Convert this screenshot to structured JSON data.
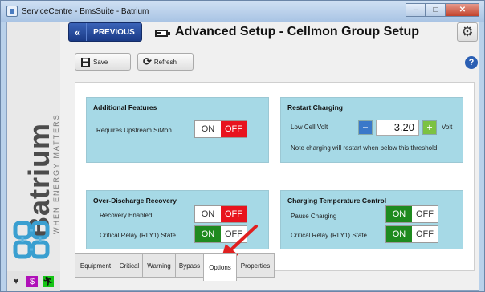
{
  "window": {
    "title": "ServiceCentre - BmsSuite - Batrium",
    "controls": {
      "minimize": "–",
      "maximize": "□",
      "close": "✕"
    }
  },
  "sidebar": {
    "brand": "Batrium",
    "tagline": "WHEN ENERGY MATTERS",
    "bottom_icons": [
      "heart-icon",
      "dollar-icon",
      "runner-icon"
    ]
  },
  "header": {
    "previous_label": "PREVIOUS",
    "previous_glyph": "«",
    "page_title": "Advanced Setup - Cellmon Group Setup"
  },
  "toolbar": {
    "save_label": "Save",
    "refresh_label": "Refresh",
    "help_glyph": "?"
  },
  "groups": {
    "additional_features": {
      "title": "Additional Features",
      "rows": [
        {
          "label": "Requires Upstream SiMon",
          "on": "ON",
          "off": "OFF",
          "state": "off"
        }
      ]
    },
    "restart_charging": {
      "title": "Restart Charging",
      "low_cell_volt_label": "Low Cell Volt",
      "low_cell_volt_value": "3.20",
      "unit": "Volt",
      "minus": "−",
      "plus": "+",
      "note": "Note charging will restart when below this threshold"
    },
    "over_discharge": {
      "title": "Over-Discharge Recovery",
      "rows": [
        {
          "label": "Recovery Enabled",
          "on": "ON",
          "off": "OFF",
          "state": "off"
        },
        {
          "label": "Critical Relay (RLY1) State",
          "on": "ON",
          "off": "OFF",
          "state": "on"
        }
      ]
    },
    "charging_temp": {
      "title": "Charging Temperature Control",
      "rows": [
        {
          "label": "Pause Charging",
          "on": "ON",
          "off": "OFF",
          "state": "on"
        },
        {
          "label": "Critical Relay (RLY1) State",
          "on": "ON",
          "off": "OFF",
          "state": "on"
        }
      ]
    }
  },
  "tabs": [
    {
      "label": "Equipment",
      "active": false
    },
    {
      "label": "Critical",
      "active": false
    },
    {
      "label": "Warning",
      "active": false
    },
    {
      "label": "Bypass",
      "active": false
    },
    {
      "label": "Options",
      "active": true
    },
    {
      "label": "Properties",
      "active": false
    }
  ],
  "colors": {
    "accent": "#1a3a86",
    "group_bg": "#a6d9e6",
    "toggle_off_active": "#e8141e",
    "toggle_on_active": "#1f8a1f",
    "annotation_arrow": "#e02020"
  }
}
